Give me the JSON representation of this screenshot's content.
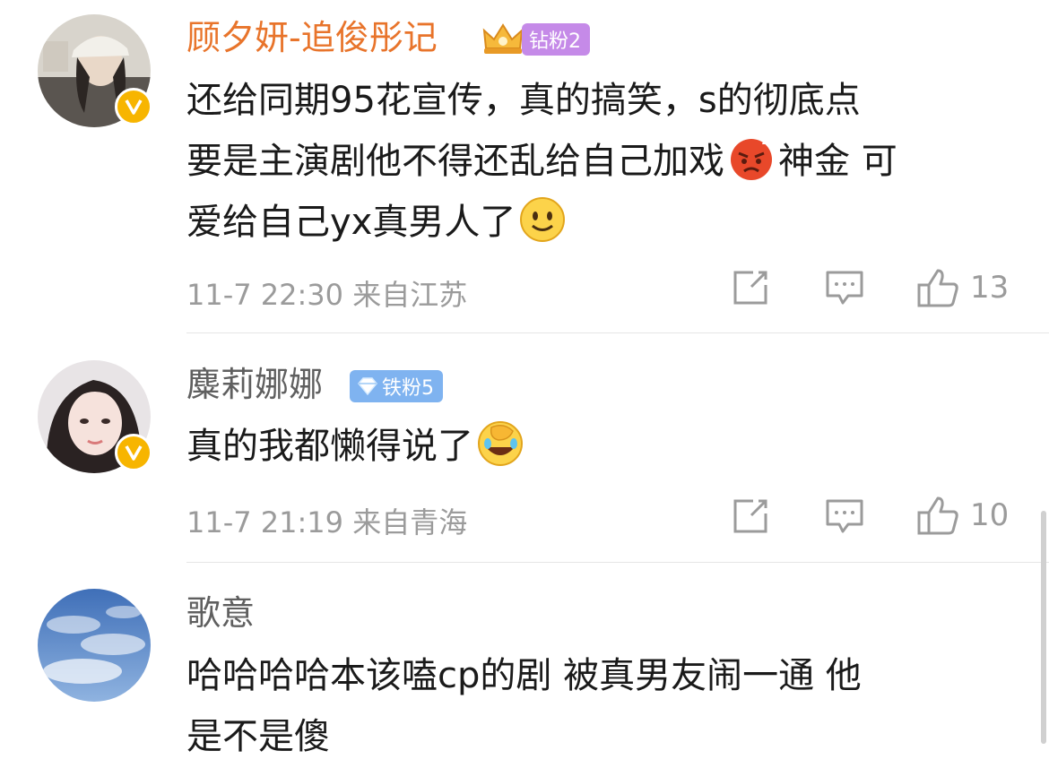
{
  "comments": [
    {
      "username": "顾夕妍-追俊彤记",
      "badge": "钻粉2",
      "text_lines": [
        "还给同期95花宣传，真的搞笑，s的彻底点",
        "要是主演剧他不得还乱给自己加戏",
        "神金 可",
        "爱给自己yx真男人了"
      ],
      "meta": "11-7 22:30 来自江苏",
      "likes": "13"
    },
    {
      "username": "麋莉娜娜",
      "badge": "铁粉5",
      "text": "真的我都懒得说了",
      "meta": "11-7 21:19 来自青海",
      "likes": "10"
    },
    {
      "username": "歌意",
      "text_lines": [
        "哈哈哈哈本该嗑cp的剧 被真男友闹一通  他",
        "是不是傻"
      ]
    }
  ],
  "colors": {
    "vip_name": "#e8742b",
    "name": "#5f5f5f",
    "meta": "#9b9b9b",
    "badge_diamond": "#c58ae8",
    "badge_iron": "#7fb3f0",
    "verified": "#f7b500"
  }
}
